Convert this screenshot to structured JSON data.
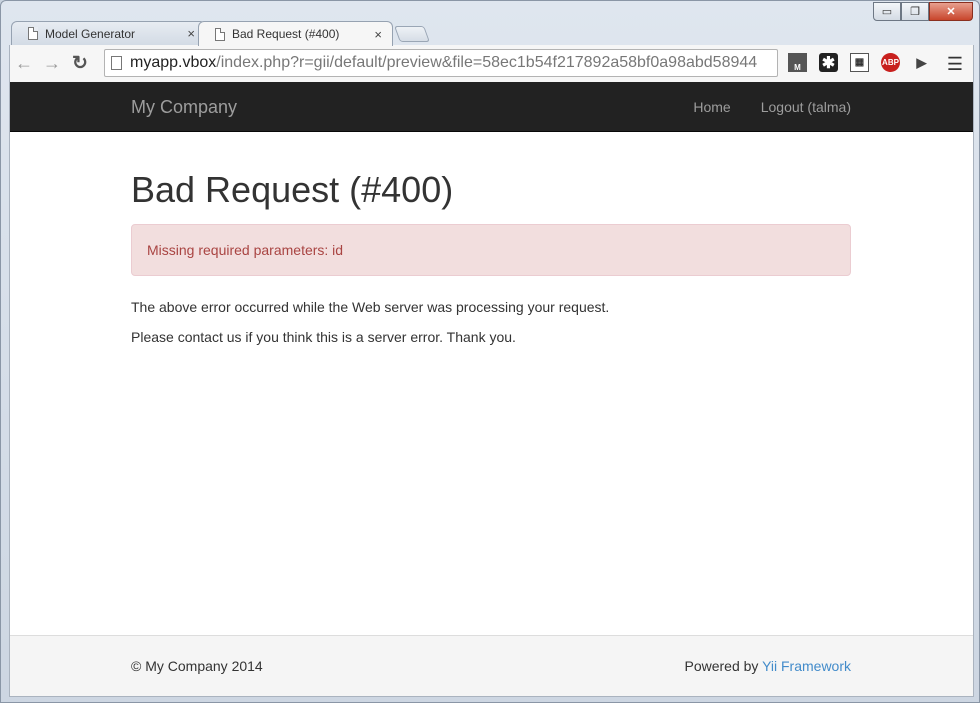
{
  "browser": {
    "tabs": [
      {
        "title": "Model Generator",
        "close": "×"
      },
      {
        "title": "Bad Request (#400)",
        "close": "×"
      }
    ],
    "window_controls": {
      "minimize": "▭",
      "maximize": "❐",
      "close": "✕"
    },
    "url": {
      "host": "myapp.vbox",
      "path": "/index.php?r=gii/default/preview&file=58ec1b54f217892a58bf0a98abd58944"
    },
    "extensions": {
      "m": "M",
      "star": "✱",
      "net": "▦",
      "abp": "ABP",
      "vid": "▶"
    },
    "menu": "☰",
    "nav": {
      "back": "←",
      "forward": "→",
      "reload": "↻"
    }
  },
  "navbar": {
    "brand": "My Company",
    "links": [
      "Home",
      "Logout (talma)"
    ]
  },
  "main": {
    "title": "Bad Request (#400)",
    "alert": "Missing required parameters: id",
    "paragraphs": [
      "The above error occurred while the Web server was processing your request.",
      "Please contact us if you think this is a server error. Thank you."
    ]
  },
  "footer": {
    "copyright": "© My Company 2014",
    "powered_prefix": "Powered by ",
    "powered_link": "Yii Framework"
  },
  "colors": {
    "navbar_bg": "#222222",
    "alert_bg": "#f2dede",
    "alert_text": "#a94442",
    "link": "#428bca"
  }
}
